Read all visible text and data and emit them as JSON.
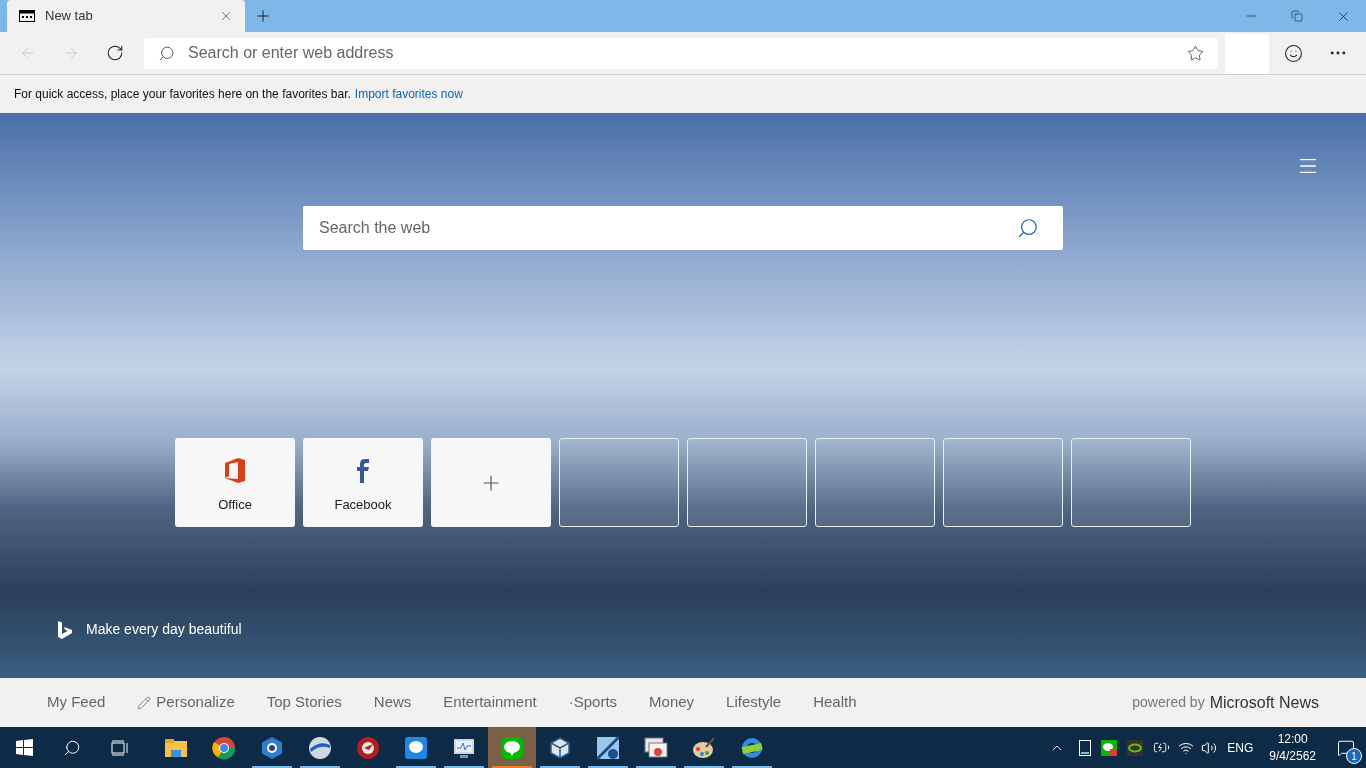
{
  "tab": {
    "title": "New tab"
  },
  "address_bar": {
    "placeholder": "Search or enter web address"
  },
  "favorites_bar": {
    "message": "For quick access, place your favorites here on the favorites bar.",
    "link": "Import favorites now"
  },
  "search": {
    "placeholder": "Search the web"
  },
  "tiles": [
    {
      "kind": "office",
      "label": "Office"
    },
    {
      "kind": "facebook",
      "label": "Facebook"
    },
    {
      "kind": "add"
    },
    {
      "kind": "empty"
    },
    {
      "kind": "empty"
    },
    {
      "kind": "empty"
    },
    {
      "kind": "empty"
    },
    {
      "kind": "empty"
    }
  ],
  "bing_caption": "Make every day beautiful",
  "news_nav": [
    {
      "kind": "link",
      "label": "My Feed"
    },
    {
      "kind": "edit",
      "label": "Personalize"
    },
    {
      "kind": "link",
      "label": "Top Stories"
    },
    {
      "kind": "link",
      "label": "News"
    },
    {
      "kind": "link",
      "label": "Entertainment"
    },
    {
      "kind": "link",
      "label": "·Sports"
    },
    {
      "kind": "link",
      "label": "Money"
    },
    {
      "kind": "link",
      "label": "Lifestyle"
    },
    {
      "kind": "link",
      "label": "Health"
    }
  ],
  "powered_by": {
    "prefix": "powered by",
    "brand": "Microsoft News"
  },
  "taskbar": {
    "apps": [
      {
        "running": false,
        "selected": false
      },
      {
        "running": false,
        "selected": false
      },
      {
        "running": true,
        "selected": false
      },
      {
        "running": true,
        "selected": false
      },
      {
        "running": false,
        "selected": false
      },
      {
        "running": true,
        "selected": false
      },
      {
        "running": true,
        "selected": false
      },
      {
        "running": true,
        "selected": true
      },
      {
        "running": true,
        "selected": false
      },
      {
        "running": true,
        "selected": false
      },
      {
        "running": true,
        "selected": false
      },
      {
        "running": true,
        "selected": false
      },
      {
        "running": true,
        "selected": false
      }
    ],
    "language": "ENG",
    "time": "12:00",
    "date": "9/4/2562",
    "notifications": "1"
  }
}
